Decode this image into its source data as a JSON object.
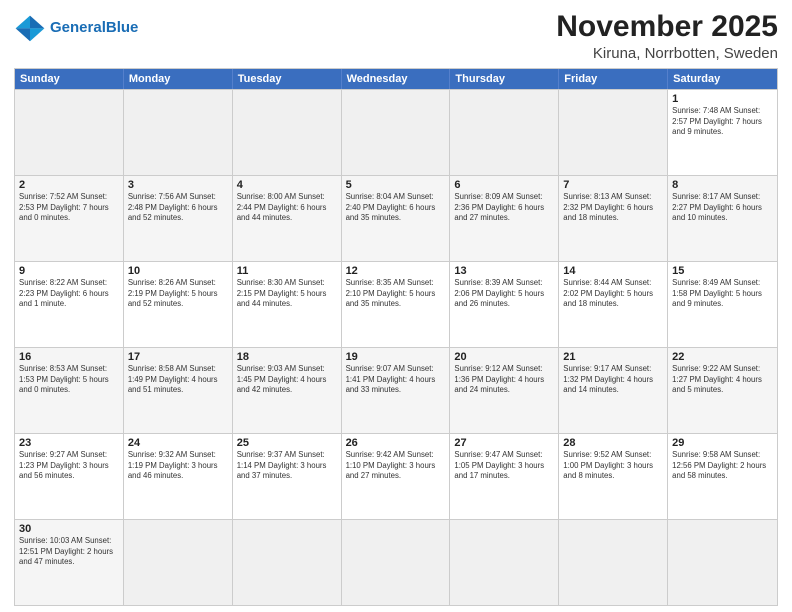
{
  "header": {
    "logo_general": "General",
    "logo_blue": "Blue",
    "title": "November 2025",
    "subtitle": "Kiruna, Norrbotten, Sweden"
  },
  "days": [
    "Sunday",
    "Monday",
    "Tuesday",
    "Wednesday",
    "Thursday",
    "Friday",
    "Saturday"
  ],
  "rows": [
    [
      {
        "day": "",
        "info": "",
        "empty": true
      },
      {
        "day": "",
        "info": "",
        "empty": true
      },
      {
        "day": "",
        "info": "",
        "empty": true
      },
      {
        "day": "",
        "info": "",
        "empty": true
      },
      {
        "day": "",
        "info": "",
        "empty": true
      },
      {
        "day": "",
        "info": "",
        "empty": true
      },
      {
        "day": "1",
        "info": "Sunrise: 7:48 AM\nSunset: 2:57 PM\nDaylight: 7 hours\nand 9 minutes."
      }
    ],
    [
      {
        "day": "2",
        "info": "Sunrise: 7:52 AM\nSunset: 2:53 PM\nDaylight: 7 hours\nand 0 minutes."
      },
      {
        "day": "3",
        "info": "Sunrise: 7:56 AM\nSunset: 2:48 PM\nDaylight: 6 hours\nand 52 minutes."
      },
      {
        "day": "4",
        "info": "Sunrise: 8:00 AM\nSunset: 2:44 PM\nDaylight: 6 hours\nand 44 minutes."
      },
      {
        "day": "5",
        "info": "Sunrise: 8:04 AM\nSunset: 2:40 PM\nDaylight: 6 hours\nand 35 minutes."
      },
      {
        "day": "6",
        "info": "Sunrise: 8:09 AM\nSunset: 2:36 PM\nDaylight: 6 hours\nand 27 minutes."
      },
      {
        "day": "7",
        "info": "Sunrise: 8:13 AM\nSunset: 2:32 PM\nDaylight: 6 hours\nand 18 minutes."
      },
      {
        "day": "8",
        "info": "Sunrise: 8:17 AM\nSunset: 2:27 PM\nDaylight: 6 hours\nand 10 minutes."
      }
    ],
    [
      {
        "day": "9",
        "info": "Sunrise: 8:22 AM\nSunset: 2:23 PM\nDaylight: 6 hours\nand 1 minute."
      },
      {
        "day": "10",
        "info": "Sunrise: 8:26 AM\nSunset: 2:19 PM\nDaylight: 5 hours\nand 52 minutes."
      },
      {
        "day": "11",
        "info": "Sunrise: 8:30 AM\nSunset: 2:15 PM\nDaylight: 5 hours\nand 44 minutes."
      },
      {
        "day": "12",
        "info": "Sunrise: 8:35 AM\nSunset: 2:10 PM\nDaylight: 5 hours\nand 35 minutes."
      },
      {
        "day": "13",
        "info": "Sunrise: 8:39 AM\nSunset: 2:06 PM\nDaylight: 5 hours\nand 26 minutes."
      },
      {
        "day": "14",
        "info": "Sunrise: 8:44 AM\nSunset: 2:02 PM\nDaylight: 5 hours\nand 18 minutes."
      },
      {
        "day": "15",
        "info": "Sunrise: 8:49 AM\nSunset: 1:58 PM\nDaylight: 5 hours\nand 9 minutes."
      }
    ],
    [
      {
        "day": "16",
        "info": "Sunrise: 8:53 AM\nSunset: 1:53 PM\nDaylight: 5 hours\nand 0 minutes."
      },
      {
        "day": "17",
        "info": "Sunrise: 8:58 AM\nSunset: 1:49 PM\nDaylight: 4 hours\nand 51 minutes."
      },
      {
        "day": "18",
        "info": "Sunrise: 9:03 AM\nSunset: 1:45 PM\nDaylight: 4 hours\nand 42 minutes."
      },
      {
        "day": "19",
        "info": "Sunrise: 9:07 AM\nSunset: 1:41 PM\nDaylight: 4 hours\nand 33 minutes."
      },
      {
        "day": "20",
        "info": "Sunrise: 9:12 AM\nSunset: 1:36 PM\nDaylight: 4 hours\nand 24 minutes."
      },
      {
        "day": "21",
        "info": "Sunrise: 9:17 AM\nSunset: 1:32 PM\nDaylight: 4 hours\nand 14 minutes."
      },
      {
        "day": "22",
        "info": "Sunrise: 9:22 AM\nSunset: 1:27 PM\nDaylight: 4 hours\nand 5 minutes."
      }
    ],
    [
      {
        "day": "23",
        "info": "Sunrise: 9:27 AM\nSunset: 1:23 PM\nDaylight: 3 hours\nand 56 minutes."
      },
      {
        "day": "24",
        "info": "Sunrise: 9:32 AM\nSunset: 1:19 PM\nDaylight: 3 hours\nand 46 minutes."
      },
      {
        "day": "25",
        "info": "Sunrise: 9:37 AM\nSunset: 1:14 PM\nDaylight: 3 hours\nand 37 minutes."
      },
      {
        "day": "26",
        "info": "Sunrise: 9:42 AM\nSunset: 1:10 PM\nDaylight: 3 hours\nand 27 minutes."
      },
      {
        "day": "27",
        "info": "Sunrise: 9:47 AM\nSunset: 1:05 PM\nDaylight: 3 hours\nand 17 minutes."
      },
      {
        "day": "28",
        "info": "Sunrise: 9:52 AM\nSunset: 1:00 PM\nDaylight: 3 hours\nand 8 minutes."
      },
      {
        "day": "29",
        "info": "Sunrise: 9:58 AM\nSunset: 12:56 PM\nDaylight: 2 hours\nand 58 minutes."
      }
    ],
    [
      {
        "day": "30",
        "info": "Sunrise: 10:03 AM\nSunset: 12:51 PM\nDaylight: 2 hours\nand 47 minutes."
      },
      {
        "day": "",
        "info": "",
        "empty": true
      },
      {
        "day": "",
        "info": "",
        "empty": true
      },
      {
        "day": "",
        "info": "",
        "empty": true
      },
      {
        "day": "",
        "info": "",
        "empty": true
      },
      {
        "day": "",
        "info": "",
        "empty": true
      },
      {
        "day": "",
        "info": "",
        "empty": true
      }
    ]
  ]
}
